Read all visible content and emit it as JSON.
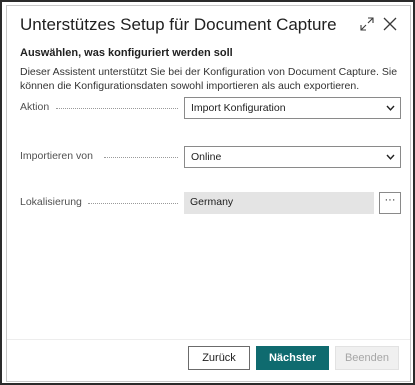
{
  "dialog": {
    "title": "Unterstützes Setup für Document Capture",
    "subheading": "Auswählen, was konfiguriert werden soll",
    "description": "Dieser Assistent unterstützt Sie bei der Konfiguration von Document Capture. Sie können die Konfigurationsdaten sowohl importieren als auch exportieren."
  },
  "fields": {
    "action": {
      "label": "Aktion",
      "value": "Import Konfiguration"
    },
    "import_from": {
      "label": "Importieren von",
      "value": "Online"
    },
    "localization": {
      "label": "Lokalisierung",
      "value": "Germany",
      "lookup_label": "···"
    }
  },
  "buttons": {
    "back": "Zurück",
    "next": "Nächster",
    "finish": "Beenden"
  },
  "icons": {
    "expand": "expand-icon",
    "close": "close-icon",
    "dropdown": "chevron-down-icon"
  },
  "colors": {
    "primary": "#0f6b6f",
    "disabled_bg": "#f0f0f0",
    "readonly_bg": "#e4e4e4"
  }
}
